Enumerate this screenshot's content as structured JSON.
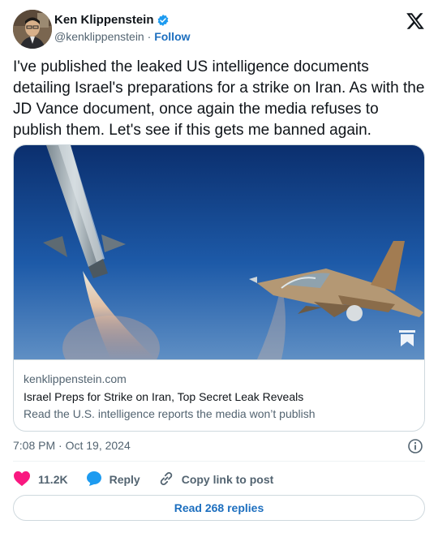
{
  "author": {
    "name": "Ken Klippenstein",
    "handle": "@kenklippenstein",
    "separator": "·",
    "follow_label": "Follow"
  },
  "tweet": {
    "text": "I've published the leaked US intelligence documents detailing Israel's preparations for a strike on Iran. As with the JD Vance document, once again the media refuses to publish them. Let's see if this gets me banned again."
  },
  "card": {
    "domain": "kenklippenstein.com",
    "title": "Israel Preps for Strike on Iran, Top Secret Leak Reveals",
    "description": "Read the U.S. intelligence reports the media won’t publish"
  },
  "meta": {
    "timestamp": "7:08 PM · Oct 19, 2024"
  },
  "actions": {
    "like_count": "11.2K",
    "reply_label": "Reply",
    "copy_label": "Copy link to post"
  },
  "footer": {
    "read_replies_label": "Read 268 replies"
  },
  "icons": {
    "verified": "verified-badge-icon",
    "logo": "x-logo-icon",
    "info": "info-icon",
    "like": "heart-icon",
    "reply": "speech-bubble-icon",
    "copy": "link-icon",
    "bookmark": "bookmark-icon"
  },
  "colors": {
    "accent": "#1d9bf0",
    "like": "#f91880",
    "link": "#1d6fbf",
    "muted": "#536471"
  }
}
